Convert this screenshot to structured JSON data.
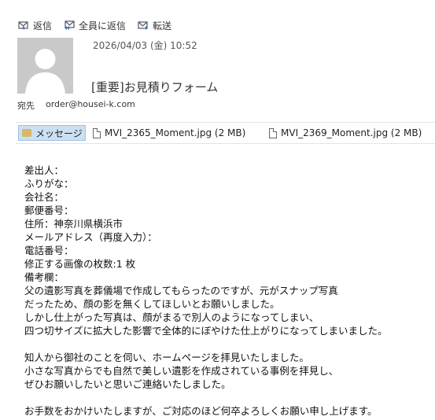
{
  "toolbar": {
    "reply_label": "返信",
    "reply_all_label": "全員に返信",
    "forward_label": "転送"
  },
  "header": {
    "date": "2026/04/03 (金) 10:52",
    "subject": "[重要]お見積りフォーム",
    "to_label": "宛先",
    "to_address": "order@housei-k.com"
  },
  "attachments": {
    "message_tab": "メッセージ",
    "files": [
      "MVI_2365_Moment.jpg (2 MB)",
      "MVI_2369_Moment.jpg (2 MB)"
    ]
  },
  "body": {
    "lines": [
      "差出人：",
      "ふりがな：",
      "会社名：",
      "郵便番号：",
      "住所：神奈川県横浜市",
      "メールアドレス（再度入力）：",
      "電話番号：",
      "修正する画像の枚数:1 枚",
      "備考欄：",
      "父の遺影写真を葬儀場で作成してもらったのですが、元がスナップ写真",
      "だったため、顔の影を無くしてほしいとお願いしました。",
      "しかし仕上がった写真は、顔がまるで別人のようになってしまい、",
      "四つ切サイズに拡大した影響で全体的にぼやけた仕上がりになってしまいました。",
      "",
      "知人から御社のことを伺い、ホームページを拝見いたしました。",
      "小さな写真からでも自然で美しい遺影を作成されている事例を拝見し、",
      "ぜひお願いしたいと思いご連絡いたしました。",
      "",
      "お手数をおかけいたしますが、ご対応のほど何卒よろしくお願い申し上げます。"
    ]
  }
}
